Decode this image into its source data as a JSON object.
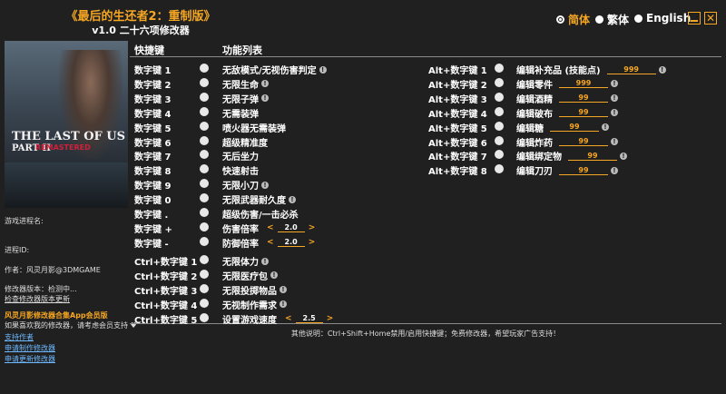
{
  "title": {
    "main": "《最后的生还者2：重制版》",
    "sub": "v1.0 二十六项修改器"
  },
  "languages": [
    {
      "label": "简体",
      "selected": true
    },
    {
      "label": "繁体",
      "selected": false
    },
    {
      "label": "English",
      "selected": false
    }
  ],
  "cover": {
    "logo_line1": "THE LAST OF US",
    "logo_line2": "PART II",
    "logo_line3": "REMASTERED"
  },
  "sidebar": {
    "process_name_label": "游戏进程名:",
    "process_id_label": "进程ID:",
    "author": "作者：风灵月影@3DMGAME",
    "version_label": "修改器版本：检测中...",
    "check_update": "检查修改器版本更新",
    "app_member": "风灵月影修改器合集App会员版",
    "support_text": "如果喜欢我的修改器，请考虑会员支持 ♥",
    "links": [
      "支持作者",
      "申请制作修改器",
      "申请更新修改器"
    ]
  },
  "headers": {
    "hotkey": "快捷键",
    "function_list": "功能列表"
  },
  "left_options": [
    {
      "key": "数字键 1",
      "name": "无敌模式/无视伤害判定",
      "info": true
    },
    {
      "key": "数字键 2",
      "name": "无限生命",
      "info": true
    },
    {
      "key": "数字键 3",
      "name": "无限子弹",
      "info": true
    },
    {
      "key": "数字键 4",
      "name": "无需装弹",
      "info": false
    },
    {
      "key": "数字键 5",
      "name": "喷火器无需装弹",
      "info": false
    },
    {
      "key": "数字键 6",
      "name": "超级精准度",
      "info": false
    },
    {
      "key": "数字键 7",
      "name": "无后坐力",
      "info": false
    },
    {
      "key": "数字键 8",
      "name": "快速射击",
      "info": false
    },
    {
      "key": "数字键 9",
      "name": "无限小刀",
      "info": true
    },
    {
      "key": "数字键 0",
      "name": "无限武器耐久度",
      "info": true
    },
    {
      "key": "数字键 .",
      "name": "超级伤害/一击必杀",
      "info": false
    },
    {
      "key": "数字键 +",
      "name": "伤害倍率",
      "info": false,
      "spin": "2.0"
    },
    {
      "key": "数字键 -",
      "name": "防御倍率",
      "info": false,
      "spin": "2.0"
    }
  ],
  "ctrl_options": [
    {
      "key": "Ctrl+数字键 1",
      "name": "无限体力",
      "info": true
    },
    {
      "key": "Ctrl+数字键 2",
      "name": "无限医疗包",
      "info": true
    },
    {
      "key": "Ctrl+数字键 3",
      "name": "无限投掷物品",
      "info": true
    },
    {
      "key": "Ctrl+数字键 4",
      "name": "无视制作需求",
      "info": true
    },
    {
      "key": "Ctrl+数字键 5",
      "name": "设置游戏速度",
      "info": false,
      "spin": "2.5"
    }
  ],
  "alt_options": [
    {
      "key": "Alt+数字键 1",
      "name": "编辑补充品 (技能点)",
      "value": "999",
      "info": true
    },
    {
      "key": "Alt+数字键 2",
      "name": "编辑零件",
      "value": "999",
      "info": true
    },
    {
      "key": "Alt+数字键 3",
      "name": "编辑酒精",
      "value": "99",
      "info": true
    },
    {
      "key": "Alt+数字键 4",
      "name": "编辑破布",
      "value": "99",
      "info": true
    },
    {
      "key": "Alt+数字键 5",
      "name": "编辑糖",
      "value": "99",
      "info": true
    },
    {
      "key": "Alt+数字键 6",
      "name": "编辑炸药",
      "value": "99",
      "info": true
    },
    {
      "key": "Alt+数字键 7",
      "name": "编辑绑定物",
      "value": "99",
      "info": true
    },
    {
      "key": "Alt+数字键 8",
      "name": "编辑刀刃",
      "value": "99",
      "info": true
    }
  ],
  "footer": "其他说明：Ctrl+Shift+Home禁用/启用快捷键；免费修改器，希望玩家广告支持！",
  "colors": {
    "accent": "#f5a623",
    "background": "#202020",
    "link": "#6db8ff"
  }
}
